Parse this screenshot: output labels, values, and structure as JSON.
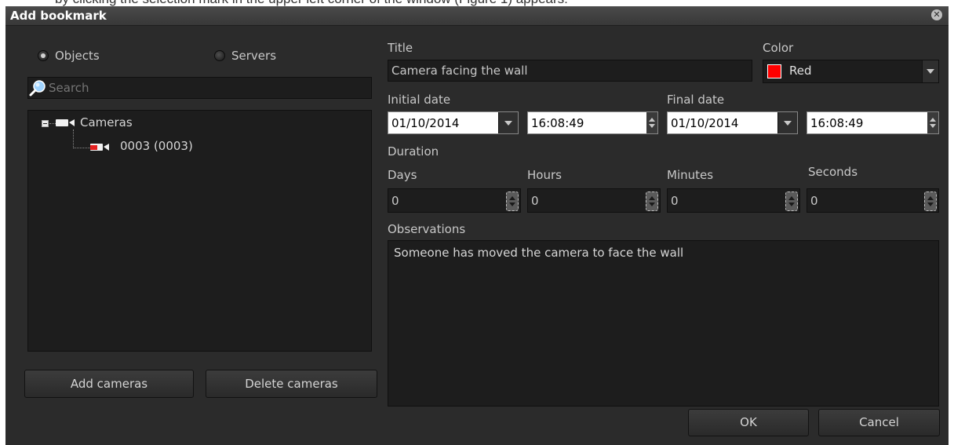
{
  "background_partial_text": "by clicking the selection mark in the upper left corner of the window (Figure 1) appears:",
  "dialog": {
    "title": "Add bookmark",
    "close_icon": "close-icon"
  },
  "left_panel": {
    "radio_objects": "Objects",
    "radio_servers": "Servers",
    "selected": "Objects",
    "search_placeholder": "Search",
    "tree": {
      "root_label": "Cameras",
      "child_label": "0003 (0003)"
    },
    "add_cameras": "Add cameras",
    "delete_cameras": "Delete cameras"
  },
  "right_panel": {
    "title_label": "Title",
    "title_value": "Camera facing the wall",
    "color_label": "Color",
    "color_value": "Red",
    "color_swatch": "#ff0000",
    "initial_date_label": "Initial date",
    "initial_date": "01/10/2014",
    "initial_time": "16:08:49",
    "final_date_label": "Final date",
    "final_date": "01/10/2014",
    "final_time": "16:08:49",
    "duration_label": "Duration",
    "days_label": "Days",
    "days_value": "0",
    "hours_label": "Hours",
    "hours_value": "0",
    "minutes_label": "Minutes",
    "minutes_value": "0",
    "seconds_label": "Seconds",
    "seconds_value": "0",
    "observations_label": "Observations",
    "observations_value": "Someone has moved the camera to face the wall",
    "ok": "OK",
    "cancel": "Cancel"
  }
}
